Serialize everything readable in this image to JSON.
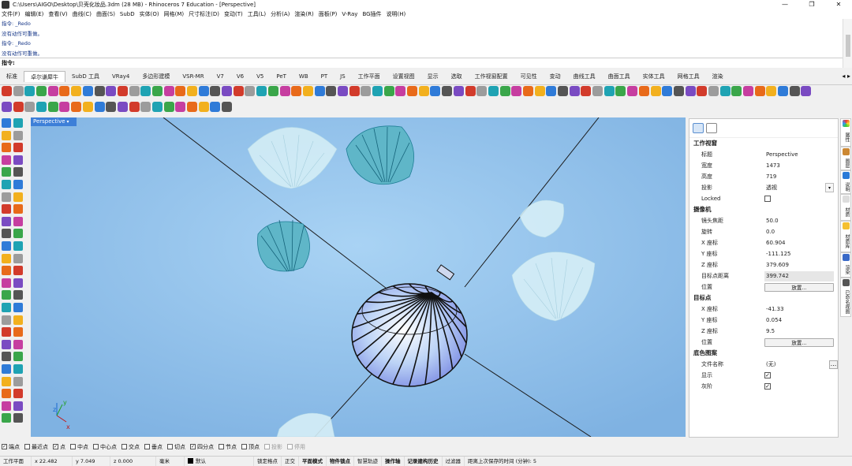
{
  "window": {
    "title": "C:\\Users\\AIGO\\Desktop\\贝壳化妆品.3dm (28 MB) - Rhinoceros 7 Education - [Perspective]",
    "controls": [
      "—",
      "❐",
      "✕"
    ]
  },
  "menu": [
    "文件(F)",
    "编辑(E)",
    "查看(V)",
    "曲线(C)",
    "曲面(S)",
    "SubD",
    "实体(O)",
    "网格(M)",
    "尺寸标注(D)",
    "变动(T)",
    "工具(L)",
    "分析(A)",
    "渲染(R)",
    "面板(P)",
    "V-Ray",
    "BG插件",
    "说明(H)"
  ],
  "command_history": [
    "指令: _Redo",
    "没有动作可重做。",
    "指令: _Redo",
    "没有动作可重做。"
  ],
  "command_prompt": "指令:",
  "toolbar_tabs": {
    "items": [
      "标准",
      "卓尔谦犀牛",
      "SubD 工具",
      "VRay4",
      "多边形建模",
      "VSR-MR",
      "V7",
      "V6",
      "V5",
      "PeT",
      "WB",
      "PT",
      "JS",
      "工作平面",
      "设置视图",
      "显示",
      "选取",
      "工作视窗配置",
      "可见性",
      "变动",
      "曲线工具",
      "曲面工具",
      "实体工具",
      "网格工具",
      "渲染"
    ],
    "active_index": 1,
    "overflow_arrows": "◂ ▸"
  },
  "viewport": {
    "name": "Perspective",
    "axis_labels": {
      "x": "x",
      "y": "y",
      "z": "z"
    }
  },
  "properties_panel": {
    "section_viewport": "工作视窗",
    "title_label": "标题",
    "title_value": "Perspective",
    "width_label": "宽度",
    "width_value": "1473",
    "height_label": "高度",
    "height_value": "719",
    "projection_label": "投影",
    "projection_value": "透视",
    "locked_label": "Locked",
    "locked_checked": false,
    "section_camera": "摄像机",
    "lens_label": "镜头焦距",
    "lens_value": "50.0",
    "rotation_label": "旋转",
    "rotation_value": "0.0",
    "cx_label": "X 座标",
    "cx_value": "60.904",
    "cy_label": "Y 座标",
    "cy_value": "-111.125",
    "cz_label": "Z 座标",
    "cz_value": "379.609",
    "target_dist_label": "目标点距离",
    "target_dist_value": "399.742",
    "position_label": "位置",
    "place_button": "放置...",
    "section_target": "目标点",
    "tx_label": "X 座标",
    "tx_value": "-41.33",
    "ty_label": "Y 座标",
    "ty_value": "0.054",
    "tz_label": "Z 座标",
    "tz_value": "9.5",
    "tposition_label": "位置",
    "tplace_button": "放置...",
    "section_wallpaper": "底色图案",
    "filename_label": "文件名称",
    "filename_value": "(无)",
    "browse_button": "...",
    "show_label": "显示",
    "show_checked": true,
    "gray_label": "灰阶",
    "gray_checked": true
  },
  "side_tabs": [
    "属性",
    "图层",
    "说明",
    "材质",
    "材质库",
    "渲染",
    "已命名视图"
  ],
  "osnap": {
    "items": [
      {
        "label": "端点",
        "checked": true,
        "enabled": true
      },
      {
        "label": "最近点",
        "checked": false,
        "enabled": true
      },
      {
        "label": "点",
        "checked": true,
        "enabled": true
      },
      {
        "label": "中点",
        "checked": false,
        "enabled": true
      },
      {
        "label": "中心点",
        "checked": false,
        "enabled": true
      },
      {
        "label": "交点",
        "checked": false,
        "enabled": true
      },
      {
        "label": "垂点",
        "checked": false,
        "enabled": true
      },
      {
        "label": "切点",
        "checked": false,
        "enabled": true
      },
      {
        "label": "四分点",
        "checked": true,
        "enabled": true
      },
      {
        "label": "节点",
        "checked": false,
        "enabled": true
      },
      {
        "label": "顶点",
        "checked": false,
        "enabled": true
      },
      {
        "label": "投影",
        "checked": false,
        "enabled": false
      },
      {
        "label": "停用",
        "checked": false,
        "enabled": false
      }
    ]
  },
  "status": {
    "cplane": "工作平面",
    "x": "x 22.482",
    "y": "y 7.049",
    "z": "z 0.000",
    "units": "毫米",
    "layer": "默认",
    "grid_snap": "锁定格点",
    "ortho": "正交",
    "planar": "平面模式",
    "osnap": "物件锁点",
    "smarttrack": "智慧轨迹",
    "gumball": "操作轴",
    "history": "记录建构历史",
    "filter": "过滤器",
    "autosave": "距离上次保存的时间 (分钟): 5"
  },
  "colors": {
    "viewport_bg": "#8fbfe6",
    "viewport_tab": "#3d7fd8",
    "shell_wire": "#2a8fa8",
    "shell_light": "#c8ecf4"
  }
}
